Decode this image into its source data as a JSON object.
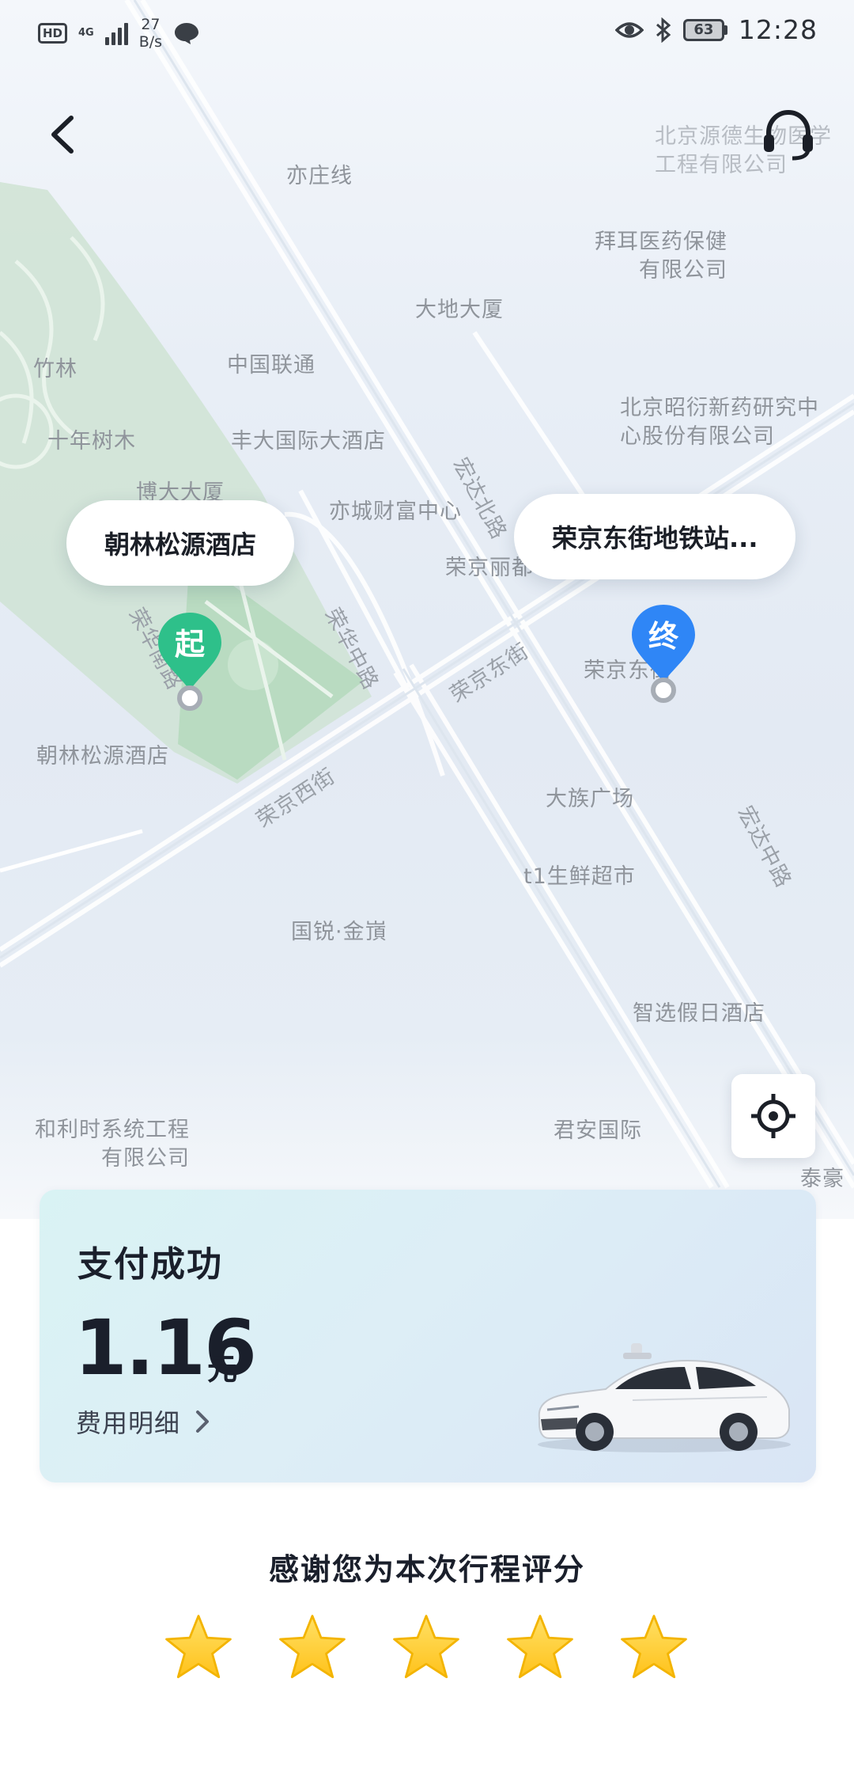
{
  "status_bar": {
    "hd_badge": "HD",
    "network": "4G",
    "speed_value": "27",
    "speed_unit": "B/s",
    "battery": "63",
    "time": "12:28"
  },
  "icons": {
    "back": "back-arrow-icon",
    "support": "headset-icon",
    "locate": "locate-crosshair-icon",
    "fee_detail": "chevron-right-icon",
    "star": "star-icon"
  },
  "map": {
    "places": [
      {
        "name": "亦庄线"
      },
      {
        "name": "北京源德生物医学工程有限公司"
      },
      {
        "name": "拜耳医药保健有限公司"
      },
      {
        "name": "大地大厦"
      },
      {
        "name": "中国联通"
      },
      {
        "name": "竹林"
      },
      {
        "name": "十年树木"
      },
      {
        "name": "丰大国际大酒店"
      },
      {
        "name": "北京昭衍新药研究中心股份有限公司"
      },
      {
        "name": "博大大厦"
      },
      {
        "name": "亦城财富中心"
      },
      {
        "name": "荣京丽都"
      },
      {
        "name": "朝林松源酒店"
      },
      {
        "name": "荣京东街"
      },
      {
        "name": "大族广场"
      },
      {
        "name": "t1生鲜超市"
      },
      {
        "name": "国锐·金嵿"
      },
      {
        "name": "智选假日酒店"
      },
      {
        "name": "和利时系统工程有限公司"
      },
      {
        "name": "君安国际"
      },
      {
        "name": "泰豪"
      }
    ],
    "roads": [
      "宏达北路",
      "荣华中路",
      "荣京东街",
      "荣京西街",
      "宏达中路",
      "荣华南路"
    ],
    "start_marker": {
      "glyph": "起",
      "label": "朝林松源酒店",
      "color": "#2ec08a"
    },
    "end_marker": {
      "glyph": "终",
      "label": "荣京东街地铁站...",
      "color": "#2f86f6"
    }
  },
  "payment": {
    "title": "支付成功",
    "amount": "1.16",
    "unit": "元",
    "detail_link": "费用明细"
  },
  "rating": {
    "title": "感谢您为本次行程评分",
    "stars_total": 5,
    "star_color": "#ffc21a"
  }
}
